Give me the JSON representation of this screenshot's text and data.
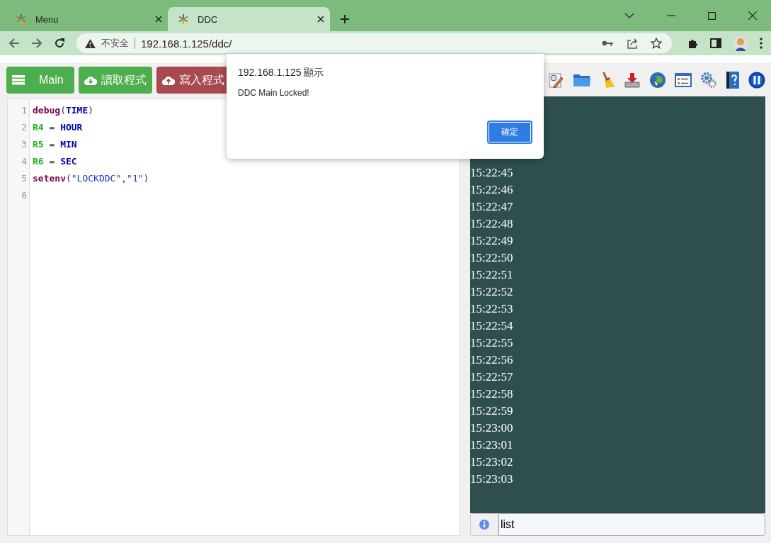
{
  "browser": {
    "tabs": [
      {
        "title": "Menu",
        "selected": false
      },
      {
        "title": "DDC",
        "selected": true
      }
    ],
    "address": {
      "security": "不安全",
      "url": "192.168.1.125/ddc/"
    }
  },
  "toolbar": {
    "buttons": [
      {
        "label": "Main",
        "kind": "menu"
      },
      {
        "label": "讀取程式",
        "kind": "download"
      },
      {
        "label": "寫入程式",
        "kind": "upload"
      }
    ]
  },
  "editor": {
    "lines": [
      {
        "number": "1",
        "tokens": [
          {
            "text": "debug",
            "kind": "func"
          },
          {
            "text": "(",
            "kind": "plain"
          },
          {
            "text": "TIME",
            "kind": "keyword"
          },
          {
            "text": ")",
            "kind": "plain"
          }
        ]
      },
      {
        "number": "2",
        "tokens": [
          {
            "text": "R4",
            "kind": "var"
          },
          {
            "text": " = ",
            "kind": "plain"
          },
          {
            "text": "HOUR",
            "kind": "keyword"
          }
        ]
      },
      {
        "number": "3",
        "tokens": [
          {
            "text": "R5",
            "kind": "var"
          },
          {
            "text": " = ",
            "kind": "plain"
          },
          {
            "text": "MIN",
            "kind": "keyword"
          }
        ]
      },
      {
        "number": "4",
        "tokens": [
          {
            "text": "R6",
            "kind": "var"
          },
          {
            "text": " = ",
            "kind": "plain"
          },
          {
            "text": "SEC",
            "kind": "keyword"
          }
        ]
      },
      {
        "number": "5",
        "tokens": [
          {
            "text": "setenv",
            "kind": "func"
          },
          {
            "text": "(",
            "kind": "plain"
          },
          {
            "text": "\"LOCKDDC\"",
            "kind": "string"
          },
          {
            "text": ",",
            "kind": "plain"
          },
          {
            "text": "\"1\"",
            "kind": "string"
          },
          {
            "text": ")",
            "kind": "plain"
          }
        ]
      },
      {
        "number": "6"
      }
    ]
  },
  "console": {
    "lines": [
      "15:22:45",
      "15:22:46",
      "15:22:47",
      "15:22:48",
      "15:22:49",
      "15:22:50",
      "15:22:51",
      "15:22:52",
      "15:22:53",
      "15:22:54",
      "15:22:55",
      "15:22:56",
      "15:22:57",
      "15:22:58",
      "15:22:59",
      "15:23:00",
      "15:23:01",
      "15:23:02",
      "15:23:03"
    ],
    "input": {
      "value": "list"
    }
  },
  "dialog": {
    "title": "192.168.1.125 顯示",
    "message": "DDC Main Locked!",
    "button": "確定"
  }
}
